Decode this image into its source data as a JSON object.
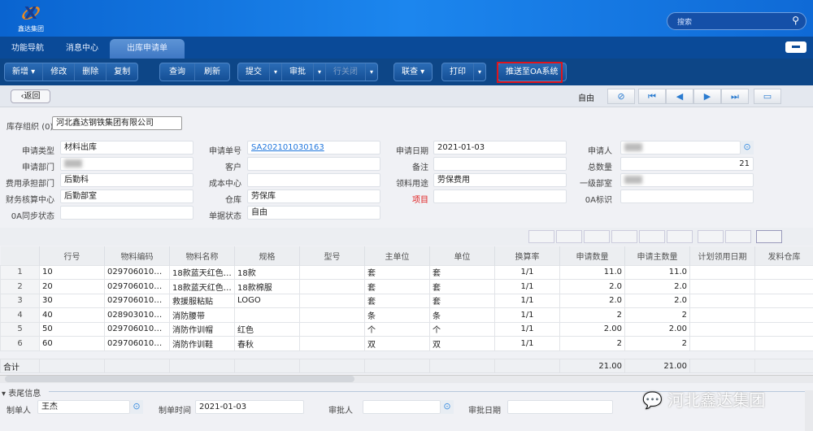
{
  "header": {
    "logo_text": "鑫达集团",
    "search_placeholder": "搜索"
  },
  "tabs": [
    {
      "label": "功能导航"
    },
    {
      "label": "消息中心"
    },
    {
      "label": "出库申请单"
    }
  ],
  "toolbar": {
    "new": "新增",
    "edit": "修改",
    "delete": "删除",
    "copy": "复制",
    "query": "查询",
    "refresh": "刷新",
    "submit": "提交",
    "approve": "审批",
    "close_row": "行关闭",
    "linked_query": "联查",
    "print": "打印",
    "push_oa": "推送至OA系统"
  },
  "nav": {
    "back": "返回",
    "status": "自由"
  },
  "org": {
    "label": "库存组织",
    "hint": "(0)",
    "value": "河北鑫达钢铁集团有限公司"
  },
  "form": {
    "apply_type": {
      "label": "申请类型",
      "value": "材料出库"
    },
    "apply_no": {
      "label": "申请单号",
      "value": "SA202101030163"
    },
    "apply_date": {
      "label": "申请日期",
      "value": "2021-01-03"
    },
    "applicant": {
      "label": "申请人",
      "value": ""
    },
    "apply_dept": {
      "label": "申请部门",
      "value": ""
    },
    "customer": {
      "label": "客户",
      "value": ""
    },
    "remark": {
      "label": "备注",
      "value": ""
    },
    "total_qty": {
      "label": "总数量",
      "value": "21"
    },
    "cost_dept": {
      "label": "费用承担部门",
      "value": "后勤科"
    },
    "cost_center": {
      "label": "成本中心",
      "value": ""
    },
    "usage": {
      "label": "领料用途",
      "value": "劳保费用"
    },
    "first_dept": {
      "label": "一级部室",
      "value": ""
    },
    "fin_center": {
      "label": "财务核算中心",
      "value": "后勤部室"
    },
    "warehouse": {
      "label": "仓库",
      "value": "劳保库"
    },
    "project": {
      "label": "项目",
      "value": ""
    },
    "oa_flag": {
      "label": "0A标识",
      "value": ""
    },
    "oa_sync": {
      "label": "0A同步状态",
      "value": ""
    },
    "doc_status": {
      "label": "单据状态",
      "value": "自由"
    }
  },
  "grid": {
    "columns": [
      "",
      "行号",
      "物料编码",
      "物料名称",
      "规格",
      "型号",
      "主单位",
      "单位",
      "换算率",
      "申请数量",
      "申请主数量",
      "计划领用日期",
      "发料仓库"
    ],
    "rows": [
      [
        "1",
        "10",
        "029706010010...",
        "18款蓝天红色救...",
        "18款",
        "",
        "套",
        "套",
        "1/1",
        "11.0",
        "11.0",
        "",
        ""
      ],
      [
        "2",
        "20",
        "029706010010...",
        "18款蓝天红色救...",
        "18款棉服",
        "",
        "套",
        "套",
        "1/1",
        "2.0",
        "2.0",
        "",
        ""
      ],
      [
        "3",
        "30",
        "029706010050...",
        "救援服粘贴",
        "LOGO",
        "",
        "套",
        "套",
        "1/1",
        "2.0",
        "2.0",
        "",
        ""
      ],
      [
        "4",
        "40",
        "028903010010...",
        "消防腰带",
        "",
        "",
        "条",
        "条",
        "1/1",
        "2",
        "2",
        "",
        ""
      ],
      [
        "5",
        "50",
        "029706010050...",
        "消防作训帽",
        "红色",
        "",
        "个",
        "个",
        "1/1",
        "2.00",
        "2.00",
        "",
        ""
      ],
      [
        "6",
        "60",
        "029706010020...",
        "消防作训鞋",
        "春秋",
        "",
        "双",
        "双",
        "1/1",
        "2",
        "2",
        "",
        ""
      ]
    ],
    "sum_label": "合计",
    "sum_apply_qty": "21.00",
    "sum_main_qty": "21.00"
  },
  "footer": {
    "title": "表尾信息",
    "creator": {
      "label": "制单人",
      "value": "王杰"
    },
    "created_time": {
      "label": "制单时间",
      "value": "2021-01-03"
    },
    "approver": {
      "label": "审批人",
      "value": ""
    },
    "approve_date": {
      "label": "审批日期",
      "value": ""
    }
  },
  "watermark": "河北鑫达集团"
}
